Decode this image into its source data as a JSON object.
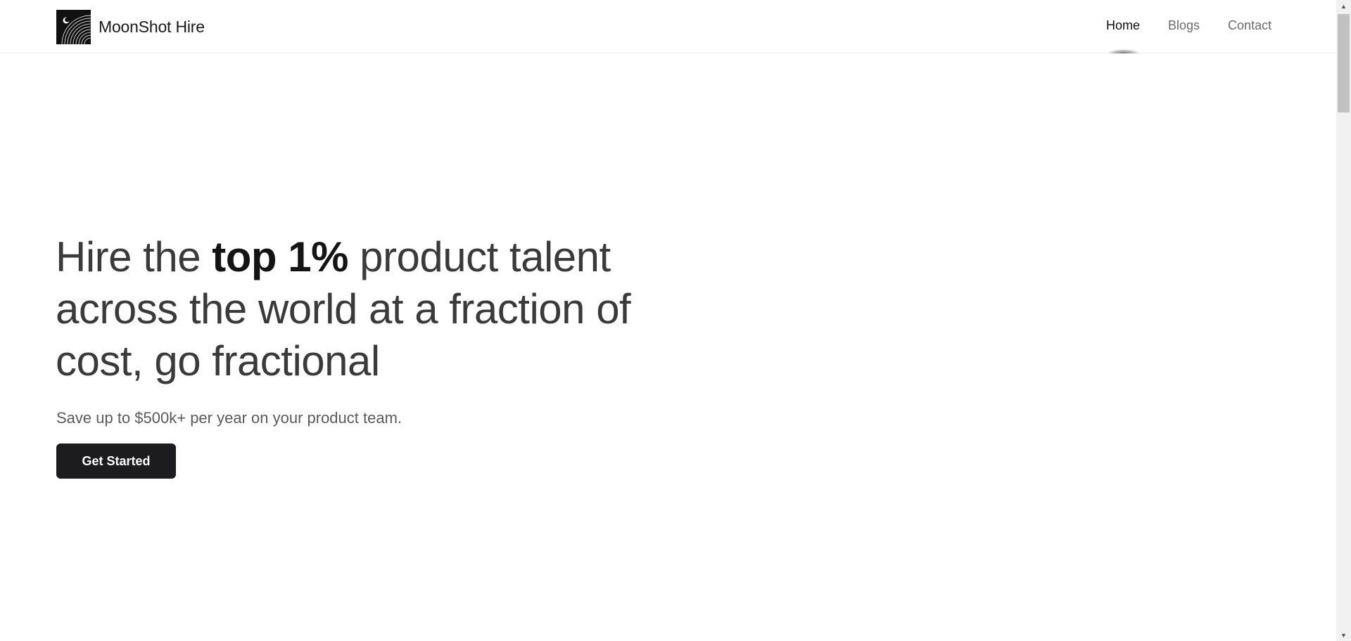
{
  "brand": {
    "name": "MoonShot Hire",
    "logo_icon": "moon-logo-icon"
  },
  "nav": {
    "items": [
      {
        "label": "Home",
        "active": true
      },
      {
        "label": "Blogs",
        "active": false
      },
      {
        "label": "Contact",
        "active": false
      }
    ]
  },
  "hero": {
    "title_pre": "Hire the ",
    "title_bold": "top 1%",
    "title_post": " product talent across the world at a fraction of cost, go fractional",
    "subtitle": "Save up to $500k+ per year on your product team.",
    "cta_label": "Get Started"
  },
  "colors": {
    "cta_background": "#1c1c1e",
    "text_primary": "#3a3a3a",
    "nav_inactive": "#6b6b6b"
  }
}
